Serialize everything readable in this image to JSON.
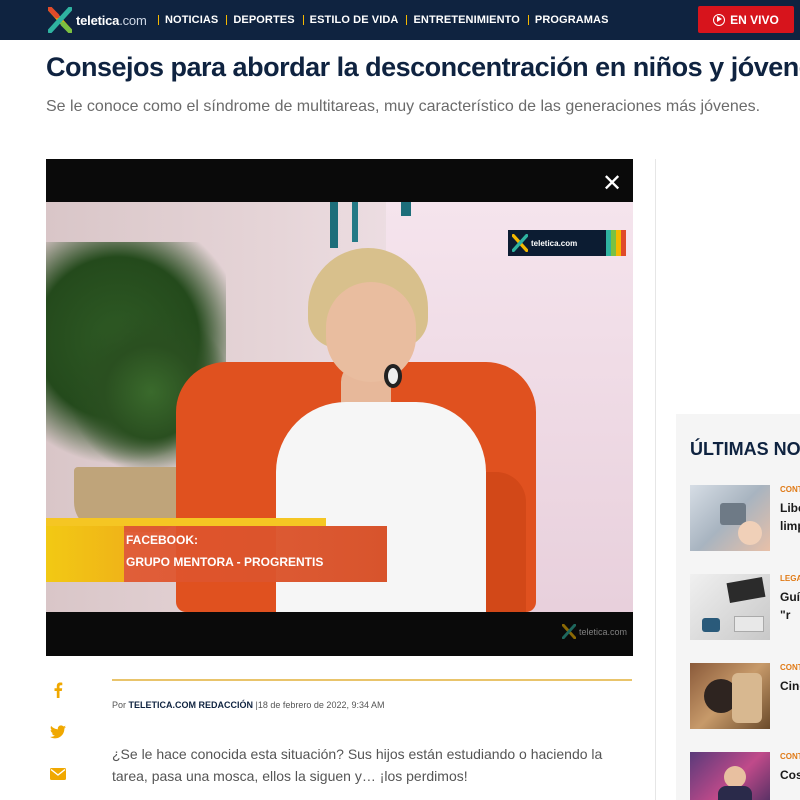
{
  "header": {
    "logo_text": "teletica",
    "logo_suffix": ".com",
    "nav": [
      "NOTICIAS",
      "DEPORTES",
      "ESTILO DE VIDA",
      "ENTRETENIMIENTO",
      "PROGRAMAS"
    ],
    "live_label": "EN VIVO"
  },
  "article": {
    "title": "Consejos para abordar la desconcentración en niños y jóvenes",
    "subtitle": "Se le conoce como el síndrome de multitareas, muy característico de las generaciones más jóvenes.",
    "byline_prefix": "Por",
    "author": "TELETICA.COM REDACCIÓN",
    "date": "|18 de febrero de 2022, 9:34 AM",
    "body": "¿Se le hace conocida esta situación? Sus hijos están estudiando o haciendo la tarea, pasa una mosca, ellos la siguen y… ¡los perdimos!"
  },
  "video": {
    "close_icon": "close-icon",
    "channel_logo": "teletica.com",
    "lower_third_line1": "FACEBOOK:",
    "lower_third_line2": "GRUPO MENTORA - PROGRENTIS",
    "watermark": "teletica.com"
  },
  "share": [
    "facebook-icon",
    "twitter-icon",
    "email-icon"
  ],
  "sidebar": {
    "title": "ÚLTIMAS NOTICIAS",
    "items": [
      {
        "category": "CONTENIDO PATROCINADO",
        "title": "Liberan importante limpieza"
      },
      {
        "category": "LEGALES",
        "title": "Guía importante la \"r"
      },
      {
        "category": "CONTENIDO PATROCINADO",
        "title": "Cinco puede de n"
      },
      {
        "category": "CONTENIDO PATROCINADO",
        "title": "Costa Schoo"
      }
    ]
  },
  "colors": {
    "nav_bg": "#0f2340",
    "accent": "#f5b800",
    "live": "#d7141c",
    "category": "#e07a16"
  }
}
